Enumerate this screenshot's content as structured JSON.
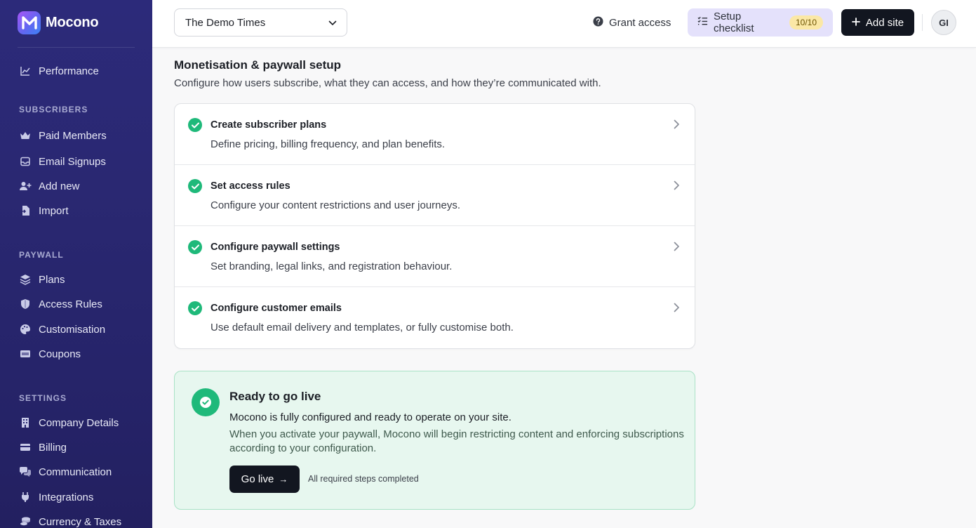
{
  "brand": {
    "name": "Mocono"
  },
  "sidebar": {
    "performance": {
      "label": "Performance",
      "icon": "chart-line-icon"
    },
    "sections": [
      {
        "title": "SUBSCRIBERS",
        "items": [
          {
            "label": "Paid Members",
            "icon": "crown-icon"
          },
          {
            "label": "Email Signups",
            "icon": "inbox-icon"
          },
          {
            "label": "Add new",
            "icon": "user-plus-icon"
          },
          {
            "label": "Import",
            "icon": "file-import-icon"
          }
        ]
      },
      {
        "title": "PAYWALL",
        "items": [
          {
            "label": "Plans",
            "icon": "layers-icon"
          },
          {
            "label": "Access Rules",
            "icon": "shield-icon"
          },
          {
            "label": "Customisation",
            "icon": "palette-icon"
          },
          {
            "label": "Coupons",
            "icon": "ticket-icon"
          }
        ]
      },
      {
        "title": "SETTINGS",
        "items": [
          {
            "label": "Company Details",
            "icon": "building-icon"
          },
          {
            "label": "Billing",
            "icon": "credit-card-icon"
          },
          {
            "label": "Communication",
            "icon": "chat-icon"
          },
          {
            "label": "Integrations",
            "icon": "plug-icon"
          },
          {
            "label": "Currency & Taxes",
            "icon": "coins-icon"
          }
        ]
      }
    ]
  },
  "topbar": {
    "site_select": {
      "value": "The Demo Times"
    },
    "grant_access": "Grant access",
    "setup_checklist": {
      "label": "Setup checklist",
      "badge": "10/10"
    },
    "add_site": "Add site",
    "avatar_initials": "GI"
  },
  "main": {
    "title": "Monetisation & paywall setup",
    "subtitle": "Configure how users subscribe, what they can access, and how they’re communicated with.",
    "steps": [
      {
        "title": "Create subscriber plans",
        "desc": "Define pricing, billing frequency, and plan benefits."
      },
      {
        "title": "Set access rules",
        "desc": "Configure your content restrictions and user journeys."
      },
      {
        "title": "Configure paywall settings",
        "desc": "Set branding, legal links, and registration behaviour."
      },
      {
        "title": "Configure customer emails",
        "desc": "Use default email delivery and templates, or fully customise both."
      }
    ],
    "go_live": {
      "title": "Ready to go live",
      "line1": "Mocono is fully configured and ready to operate on your site.",
      "line2": "When you activate your paywall, Mocono will begin restricting content and enforcing subscriptions according to your configuration.",
      "button": "Go live",
      "note": "All required steps completed"
    }
  },
  "colors": {
    "sidebar_bg": "#2a2872",
    "success": "#1fb97a",
    "primary_button": "#121620",
    "checklist_bg": "#e4e1fb",
    "badge_bg": "#fbe8a6",
    "golive_bg": "#e7f7ef"
  }
}
